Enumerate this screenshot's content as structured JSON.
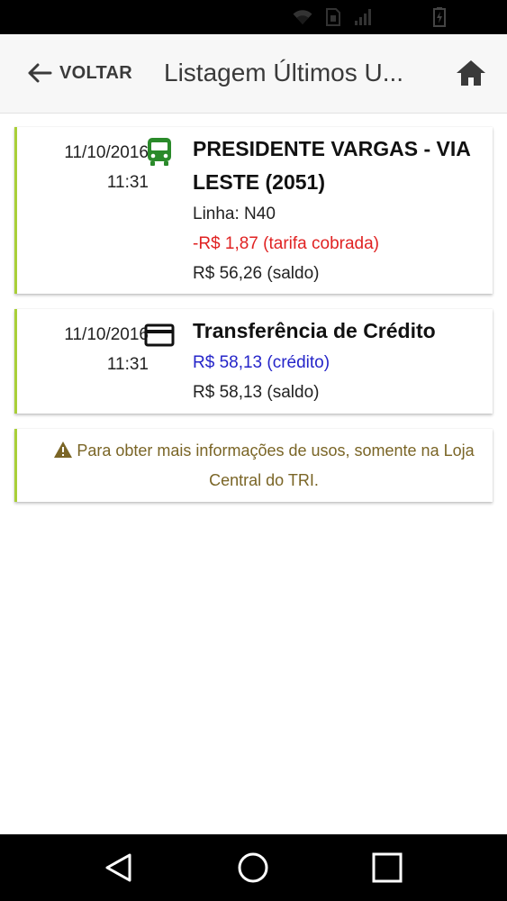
{
  "status_bar": {
    "icons": [
      "wifi-icon",
      "sim-icon",
      "signal-icon",
      "battery-icon"
    ]
  },
  "header": {
    "back_label": "VOLTAR",
    "title": "Listagem Últimos U...",
    "back_icon": "arrow-left-icon",
    "home_icon": "home-icon"
  },
  "transactions": [
    {
      "date": "11/10/2016",
      "time": "11:31",
      "icon": "bus-icon",
      "title": "PRESIDENTE VARGAS - VIA LESTE (2051)",
      "line": "Linha: N40",
      "amount": "-R$ 1,87 (tarifa cobrada)",
      "balance": "R$ 56,26 (saldo)"
    },
    {
      "date": "11/10/2016",
      "time": "11:31",
      "icon": "credit-card-icon",
      "title": "Transferência de Crédito",
      "amount": "R$ 58,13 (crédito)",
      "balance": "R$ 58,13 (saldo)"
    }
  ],
  "notice": {
    "icon": "warning-icon",
    "text": "Para obter mais informações de usos, somente na Loja Central do TRI."
  },
  "nav_bar": {
    "buttons": [
      "back-triangle-icon",
      "home-circle-icon",
      "recents-square-icon"
    ]
  },
  "colors": {
    "accent_border": "#a9cf38",
    "bus_icon": "#2a8a2a",
    "charge_red": "#e02222",
    "credit_blue": "#2525c9",
    "notice_text": "#7a6526"
  }
}
